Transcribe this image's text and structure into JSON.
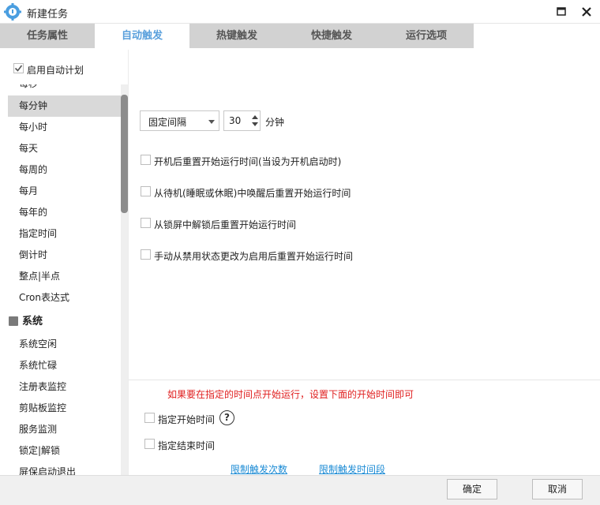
{
  "window": {
    "title": "新建任务",
    "app_icon": "gear-icon",
    "maximize_icon": "maximize-icon",
    "close_icon": "close-icon"
  },
  "tabs": [
    {
      "label": "任务属性",
      "active": false
    },
    {
      "label": "自动触发",
      "active": true
    },
    {
      "label": "热键触发",
      "active": false
    },
    {
      "label": "快捷触发",
      "active": false
    },
    {
      "label": "运行选项",
      "active": false
    }
  ],
  "enable_schedule": {
    "label": "启用自动计划",
    "checked": true
  },
  "schedule_list": {
    "items": [
      {
        "label": "每秒",
        "selected": false
      },
      {
        "label": "每分钟",
        "selected": true
      },
      {
        "label": "每小时",
        "selected": false
      },
      {
        "label": "每天",
        "selected": false
      },
      {
        "label": "每周的",
        "selected": false
      },
      {
        "label": "每月",
        "selected": false
      },
      {
        "label": "每年的",
        "selected": false
      },
      {
        "label": "指定时间",
        "selected": false
      },
      {
        "label": "倒计时",
        "selected": false
      },
      {
        "label": "整点|半点",
        "selected": false
      },
      {
        "label": "Cron表达式",
        "selected": false
      }
    ],
    "group": {
      "label": "系统",
      "icon": "collapse-icon"
    },
    "group_items": [
      {
        "label": "系统空闲"
      },
      {
        "label": "系统忙碌"
      },
      {
        "label": "注册表监控"
      },
      {
        "label": "剪贴板监控"
      },
      {
        "label": "服务监测"
      },
      {
        "label": "锁定|解锁"
      },
      {
        "label": "屏保启动退出"
      }
    ]
  },
  "interval": {
    "mode_value": "固定间隔",
    "amount_value": "30",
    "unit": "分钟"
  },
  "options": [
    {
      "label": "开机后重置开始运行时间(当设为开机启动时)",
      "checked": false
    },
    {
      "label": "从待机(睡眠或休眠)中唤醒后重置开始运行时间",
      "checked": false
    },
    {
      "label": "从锁屏中解锁后重置开始运行时间",
      "checked": false
    },
    {
      "label": "手动从禁用状态更改为启用后重置开始运行时间",
      "checked": false
    }
  ],
  "note": "如果要在指定的时间点开始运行，设置下面的开始时间即可",
  "start_time": {
    "label": "指定开始时间",
    "checked": false,
    "help": "?"
  },
  "end_time": {
    "label": "指定结束时间",
    "checked": false
  },
  "links": {
    "limit_count": "限制触发次数",
    "limit_period": "限制触发时间段"
  },
  "buttons": {
    "ok": "确定",
    "cancel": "取消"
  },
  "colors": {
    "accent": "#5aa0dc",
    "note": "#e02020",
    "link": "#1a8ad4"
  }
}
